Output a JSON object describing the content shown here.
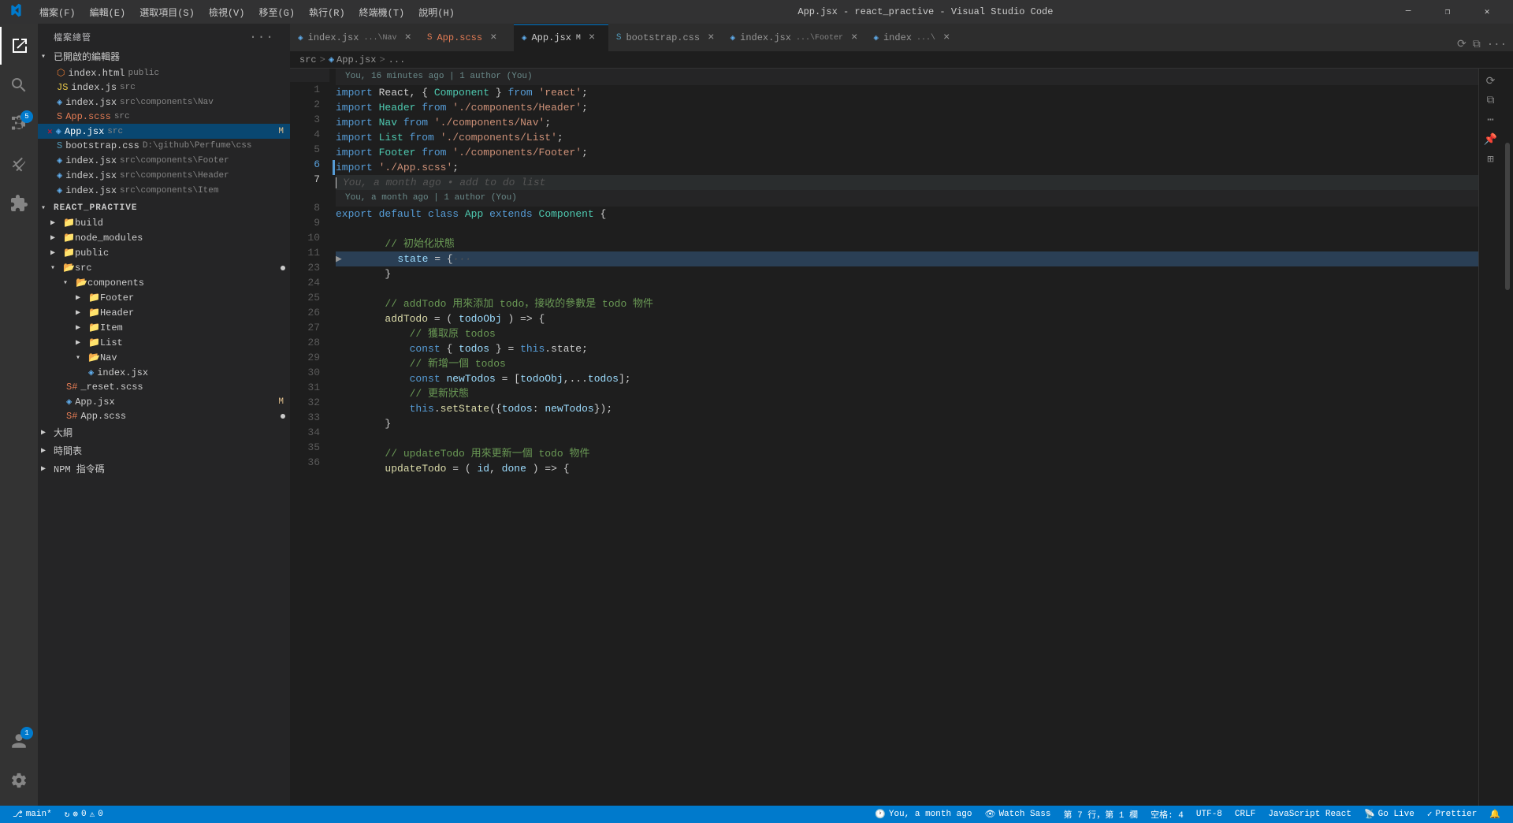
{
  "titlebar": {
    "title": "App.jsx - react_practive - Visual Studio Code",
    "menus": [
      "檔案(F)",
      "編輯(E)",
      "選取項目(S)",
      "檢視(V)",
      "移至(G)",
      "執行(R)",
      "終端機(T)",
      "說明(H)"
    ],
    "controls": [
      "─",
      "❐",
      "✕"
    ]
  },
  "sidebar": {
    "header": "檔案總管",
    "sections": {
      "opened_editors": "已開啟的編輯器",
      "open_files": [
        {
          "icon": "html",
          "name": "index.html",
          "path": "public",
          "active": false,
          "modified": false
        },
        {
          "icon": "js",
          "name": "index.js",
          "path": "src",
          "active": false,
          "modified": false
        },
        {
          "icon": "jsx",
          "name": "index.jsx",
          "path": "src/components/Nav",
          "active": false,
          "modified": false
        },
        {
          "icon": "css",
          "name": "App.scss",
          "path": "src",
          "active": false,
          "modified": false
        },
        {
          "icon": "jsx",
          "name": "App.jsx",
          "path": "src",
          "active": true,
          "modified": true,
          "badge": "M"
        },
        {
          "icon": "css",
          "name": "bootstrap.css",
          "path": "D:\\github\\Perfume\\css",
          "active": false,
          "modified": false
        },
        {
          "icon": "jsx",
          "name": "index.jsx",
          "path": "src/components/Footer",
          "active": false,
          "modified": false
        },
        {
          "icon": "jsx",
          "name": "index.jsx",
          "path": "src/components/Header",
          "active": false,
          "modified": false
        },
        {
          "icon": "jsx",
          "name": "index.jsx",
          "path": "src/components/Item",
          "active": false,
          "modified": false
        }
      ],
      "project_name": "REACT_PRACTIVE",
      "tree": [
        {
          "type": "folder",
          "name": "build",
          "level": 1,
          "open": false
        },
        {
          "type": "folder",
          "name": "node_modules",
          "level": 1,
          "open": false
        },
        {
          "type": "folder",
          "name": "public",
          "level": 1,
          "open": false
        },
        {
          "type": "folder",
          "name": "src",
          "level": 1,
          "open": true,
          "children": [
            {
              "type": "folder",
              "name": "components",
              "level": 2,
              "open": true,
              "children": [
                {
                  "type": "folder",
                  "name": "Footer",
                  "level": 3,
                  "open": false
                },
                {
                  "type": "folder",
                  "name": "Header",
                  "level": 3,
                  "open": false
                },
                {
                  "type": "folder",
                  "name": "Item",
                  "level": 3,
                  "open": false
                },
                {
                  "type": "folder",
                  "name": "List",
                  "level": 3,
                  "open": false
                },
                {
                  "type": "folder",
                  "name": "Nav",
                  "level": 3,
                  "open": true,
                  "children": [
                    {
                      "type": "file",
                      "icon": "jsx",
                      "name": "index.jsx",
                      "level": 4
                    }
                  ]
                }
              ]
            },
            {
              "type": "file",
              "icon": "scss",
              "name": "_reset.scss",
              "level": 2
            },
            {
              "type": "file",
              "icon": "jsx",
              "name": "App.jsx",
              "level": 2,
              "modified": true,
              "badge": "M"
            },
            {
              "type": "file",
              "icon": "scss",
              "name": "App.scss",
              "level": 2,
              "dot": true
            }
          ]
        },
        {
          "type": "section",
          "name": "大綱",
          "level": 0,
          "open": false
        },
        {
          "type": "section",
          "name": "時間表",
          "level": 0,
          "open": false
        },
        {
          "type": "section",
          "name": "NPM 指令碼",
          "level": 0,
          "open": false
        }
      ]
    }
  },
  "tabs": [
    {
      "id": "tab1",
      "icon": "jsx-icon",
      "name": "index.jsx",
      "path": "...\\Nav",
      "active": false,
      "modified": false,
      "color": "#cccccc"
    },
    {
      "id": "tab2",
      "icon": "css-icon",
      "name": "App.scss",
      "path": "",
      "active": false,
      "modified": false,
      "color": "#e27b54"
    },
    {
      "id": "tab3",
      "icon": "jsx-icon",
      "name": "App.jsx",
      "path": "",
      "active": true,
      "modified": true,
      "color": "#cccccc"
    },
    {
      "id": "tab4",
      "icon": "css-icon",
      "name": "bootstrap.css",
      "path": "",
      "active": false,
      "modified": false,
      "color": "#cccccc"
    },
    {
      "id": "tab5",
      "icon": "jsx-icon",
      "name": "index.jsx",
      "path": "...\\Footer",
      "active": false,
      "modified": false,
      "color": "#cccccc"
    },
    {
      "id": "tab6",
      "icon": "jsx-icon",
      "name": "index",
      "path": "...\\",
      "active": false,
      "modified": false,
      "color": "#cccccc"
    }
  ],
  "breadcrumb": {
    "parts": [
      "src",
      ">",
      "App.jsx",
      ">",
      "..."
    ]
  },
  "blame": {
    "line_top": "You, 16 minutes ago | 1 author (You)",
    "line_mid": "You, a month ago | 1 author (You)",
    "ghost_text": "You, a month ago • add to do list"
  },
  "code_lines": [
    {
      "num": 1,
      "tokens": [
        {
          "t": "import",
          "c": "kw"
        },
        {
          "t": " React, { ",
          "c": "op"
        },
        {
          "t": "Component",
          "c": "cls"
        },
        {
          "t": " } from ",
          "c": "op"
        },
        {
          "t": "'react'",
          "c": "str"
        },
        {
          "t": ";",
          "c": "op"
        }
      ]
    },
    {
      "num": 2,
      "tokens": [
        {
          "t": "import",
          "c": "kw"
        },
        {
          "t": " Header ",
          "c": "op"
        },
        {
          "t": "from",
          "c": "kw"
        },
        {
          "t": " ",
          "c": "op"
        },
        {
          "t": "'./components/Header'",
          "c": "str"
        },
        {
          "t": ";",
          "c": "op"
        }
      ]
    },
    {
      "num": 3,
      "tokens": [
        {
          "t": "import",
          "c": "kw"
        },
        {
          "t": " Nav ",
          "c": "op"
        },
        {
          "t": "from",
          "c": "kw"
        },
        {
          "t": " ",
          "c": "op"
        },
        {
          "t": "'./components/Nav'",
          "c": "str"
        },
        {
          "t": ";",
          "c": "op"
        }
      ]
    },
    {
      "num": 4,
      "tokens": [
        {
          "t": "import",
          "c": "kw"
        },
        {
          "t": " List ",
          "c": "op"
        },
        {
          "t": "from",
          "c": "kw"
        },
        {
          "t": " ",
          "c": "op"
        },
        {
          "t": "'./components/List'",
          "c": "str"
        },
        {
          "t": ";",
          "c": "op"
        }
      ]
    },
    {
      "num": 5,
      "tokens": [
        {
          "t": "import",
          "c": "kw"
        },
        {
          "t": " Footer ",
          "c": "op"
        },
        {
          "t": "from",
          "c": "kw"
        },
        {
          "t": " ",
          "c": "op"
        },
        {
          "t": "'./components/Footer'",
          "c": "str"
        },
        {
          "t": ";",
          "c": "op"
        }
      ]
    },
    {
      "num": 6,
      "tokens": [
        {
          "t": "import",
          "c": "kw"
        },
        {
          "t": " ",
          "c": "op"
        },
        {
          "t": "'./App.scss'",
          "c": "str"
        },
        {
          "t": ";",
          "c": "op"
        }
      ],
      "git_modified": true
    },
    {
      "num": 7,
      "tokens": [
        {
          "t": "",
          "c": "op"
        }
      ],
      "cursor": true,
      "ghost": "You, a month ago • add to do list"
    },
    {
      "num": 8,
      "tokens": [
        {
          "t": "export",
          "c": "kw"
        },
        {
          "t": " ",
          "c": "op"
        },
        {
          "t": "default",
          "c": "kw"
        },
        {
          "t": " ",
          "c": "op"
        },
        {
          "t": "class",
          "c": "kw"
        },
        {
          "t": " App ",
          "c": "cls"
        },
        {
          "t": "extends",
          "c": "kw"
        },
        {
          "t": " Component ",
          "c": "cls"
        },
        {
          "t": "{",
          "c": "op"
        }
      ]
    },
    {
      "num": 9,
      "tokens": []
    },
    {
      "num": 10,
      "tokens": [
        {
          "t": "        // 初始化狀態",
          "c": "cmt"
        }
      ]
    },
    {
      "num": 11,
      "tokens": [
        {
          "t": "        ",
          "c": "op"
        },
        {
          "t": "state",
          "c": "var"
        },
        {
          "t": " = {",
          "c": "op"
        },
        {
          "t": "···",
          "c": "ghost"
        }
      ],
      "highlight": true,
      "expandable": true
    },
    {
      "num": 23,
      "tokens": [
        {
          "t": "        }",
          "c": "op"
        }
      ]
    },
    {
      "num": 24,
      "tokens": []
    },
    {
      "num": 25,
      "tokens": [
        {
          "t": "        // addTodo 用來添加 todo，接收的參數是 todo 物件",
          "c": "cmt"
        }
      ]
    },
    {
      "num": 26,
      "tokens": [
        {
          "t": "        ",
          "c": "op"
        },
        {
          "t": "addTodo",
          "c": "fn"
        },
        {
          "t": " = ( ",
          "c": "op"
        },
        {
          "t": "todoObj",
          "c": "var"
        },
        {
          "t": " ) => {",
          "c": "op"
        }
      ]
    },
    {
      "num": 27,
      "tokens": [
        {
          "t": "            // 獲取原 todos",
          "c": "cmt"
        }
      ]
    },
    {
      "num": 28,
      "tokens": [
        {
          "t": "            ",
          "c": "op"
        },
        {
          "t": "const",
          "c": "kw"
        },
        {
          "t": " { ",
          "c": "op"
        },
        {
          "t": "todos",
          "c": "var"
        },
        {
          "t": " } = ",
          "c": "op"
        },
        {
          "t": "this",
          "c": "kw"
        },
        {
          "t": ".state;",
          "c": "op"
        }
      ]
    },
    {
      "num": 29,
      "tokens": [
        {
          "t": "            // 新增一個 todos",
          "c": "cmt"
        }
      ]
    },
    {
      "num": 30,
      "tokens": [
        {
          "t": "            ",
          "c": "op"
        },
        {
          "t": "const",
          "c": "kw"
        },
        {
          "t": " ",
          "c": "op"
        },
        {
          "t": "newTodos",
          "c": "var"
        },
        {
          "t": " = [",
          "c": "op"
        },
        {
          "t": "todoObj",
          "c": "var"
        },
        {
          "t": ",...",
          "c": "op"
        },
        {
          "t": "todos",
          "c": "var"
        },
        {
          "t": "];",
          "c": "op"
        }
      ]
    },
    {
      "num": 31,
      "tokens": [
        {
          "t": "            // 更新狀態",
          "c": "cmt"
        }
      ]
    },
    {
      "num": 32,
      "tokens": [
        {
          "t": "            ",
          "c": "op"
        },
        {
          "t": "this",
          "c": "kw"
        },
        {
          "t": ".",
          "c": "op"
        },
        {
          "t": "setState",
          "c": "fn"
        },
        {
          "t": "({",
          "c": "op"
        },
        {
          "t": "todos",
          "c": "prop"
        },
        {
          "t": ": ",
          "c": "op"
        },
        {
          "t": "newTodos",
          "c": "var"
        },
        {
          "t": "});",
          "c": "op"
        }
      ]
    },
    {
      "num": 33,
      "tokens": [
        {
          "t": "        }",
          "c": "op"
        }
      ]
    },
    {
      "num": 34,
      "tokens": []
    },
    {
      "num": 35,
      "tokens": [
        {
          "t": "        // updateTodo 用來更新一個 todo 物件",
          "c": "cmt"
        }
      ]
    },
    {
      "num": 36,
      "tokens": [
        {
          "t": "        ",
          "c": "op"
        },
        {
          "t": "updateTodo",
          "c": "fn"
        },
        {
          "t": " = ( ",
          "c": "op"
        },
        {
          "t": "id",
          "c": "var"
        },
        {
          "t": ", ",
          "c": "op"
        },
        {
          "t": "done",
          "c": "var"
        },
        {
          "t": " ) => {",
          "c": "op"
        }
      ]
    }
  ],
  "statusbar": {
    "left": [
      {
        "id": "git-branch",
        "icon": "⎇",
        "text": "main*"
      },
      {
        "id": "sync",
        "icon": "↻",
        "text": ""
      },
      {
        "id": "errors",
        "icon": "⊘",
        "text": "0"
      },
      {
        "id": "warnings",
        "icon": "⚠",
        "text": "0"
      }
    ],
    "right": [
      {
        "id": "blame-right",
        "text": "You, a month ago"
      },
      {
        "id": "watch-sass",
        "icon": "👁",
        "text": "Watch Sass"
      },
      {
        "id": "cursor-pos",
        "text": "第 7 行，第 1 欄"
      },
      {
        "id": "spaces",
        "text": "空格: 4"
      },
      {
        "id": "encoding",
        "text": "UTF-8"
      },
      {
        "id": "line-ending",
        "text": "CRLF"
      },
      {
        "id": "language",
        "text": "JavaScript React"
      },
      {
        "id": "golive",
        "icon": "📡",
        "text": "Go Live"
      },
      {
        "id": "prettier",
        "icon": "✓",
        "text": "Prettier"
      },
      {
        "id": "notifications",
        "text": "🔔"
      }
    ]
  }
}
